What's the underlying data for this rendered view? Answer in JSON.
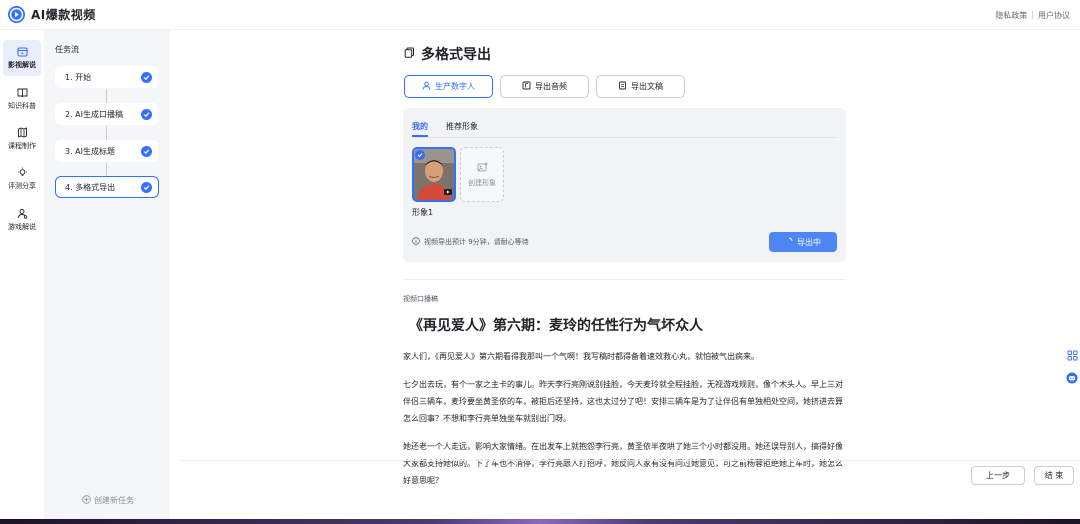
{
  "header": {
    "app_name": "AI爆款视频",
    "links": [
      "隐私政策",
      "用户协议"
    ],
    "separator": "|"
  },
  "leftnav": {
    "items": [
      {
        "label": "影视解说",
        "icon": "video-calendar-icon",
        "active": true
      },
      {
        "label": "知识科普",
        "icon": "book-icon",
        "active": false
      },
      {
        "label": "课程制作",
        "icon": "map-icon",
        "active": false
      },
      {
        "label": "评测分享",
        "icon": "lightbulb-icon",
        "active": false
      },
      {
        "label": "游戏解说",
        "icon": "user-game-icon",
        "active": false
      }
    ]
  },
  "taskflow": {
    "title": "任务流",
    "steps": [
      {
        "label": "1. 开始",
        "done": true,
        "active": false
      },
      {
        "label": "2. AI生成口播稿",
        "done": true,
        "active": false
      },
      {
        "label": "3. AI生成标题",
        "done": true,
        "active": false
      },
      {
        "label": "4. 多格式导出",
        "done": true,
        "active": true
      }
    ],
    "create_task": "创建新任务"
  },
  "main": {
    "title": "多格式导出",
    "tabs": [
      {
        "label": "生产数字人",
        "icon": "user-icon",
        "active": true
      },
      {
        "label": "导出音频",
        "icon": "audio-file-icon",
        "active": false
      },
      {
        "label": "导出文稿",
        "icon": "doc-file-icon",
        "active": false
      }
    ],
    "avatar_panel": {
      "subtabs": [
        "我的",
        "推荐形象"
      ],
      "avatar_name": "形象1",
      "create_label": "创建形象",
      "hint": "视频导出预计 9分钟，请耐心等待",
      "export_button": "导出中"
    },
    "script": {
      "label": "视频口播稿",
      "title": "《再见爱人》第六期：麦玲的任性行为气坏众人",
      "paragraphs": [
        "家人们，《再见爱人》第六期看得我那叫一个气啊！我写稿时都得备着速效救心丸，就怕被气出病来。",
        "七夕出去玩，有个一家之主卡的事儿。昨天李行亮刚说别挂脸，今天麦玲就全程挂脸，无视游戏规则，像个木头人。早上三对伴侣三辆车，麦玲要坐黄圣依的车，被拒后还坚持，这也太过分了吧！安排三辆车是为了让伴侣有单独相处空间，她挤进去算怎么回事？不想和李行亮单独坐车就别出门呀。",
        "她还老一个人走远，影响大家情绪。在出发车上就抱怨李行亮，黄圣依半夜哄了她三个小时都没用。她还误导别人，搞得好像大家都支持她似的。下了车也不消停，李行亮跟人打招呼，她反问人家有没有问过她意见，可之前杨蓉拒绝她上车时，她怎么好意思呢？"
      ]
    },
    "footer": {
      "prev": "上一步",
      "finish": "结 束"
    }
  },
  "colors": {
    "accent": "#3370ff",
    "panel_bg": "#f5f6f8",
    "card_bg": "#f2f3f5"
  }
}
